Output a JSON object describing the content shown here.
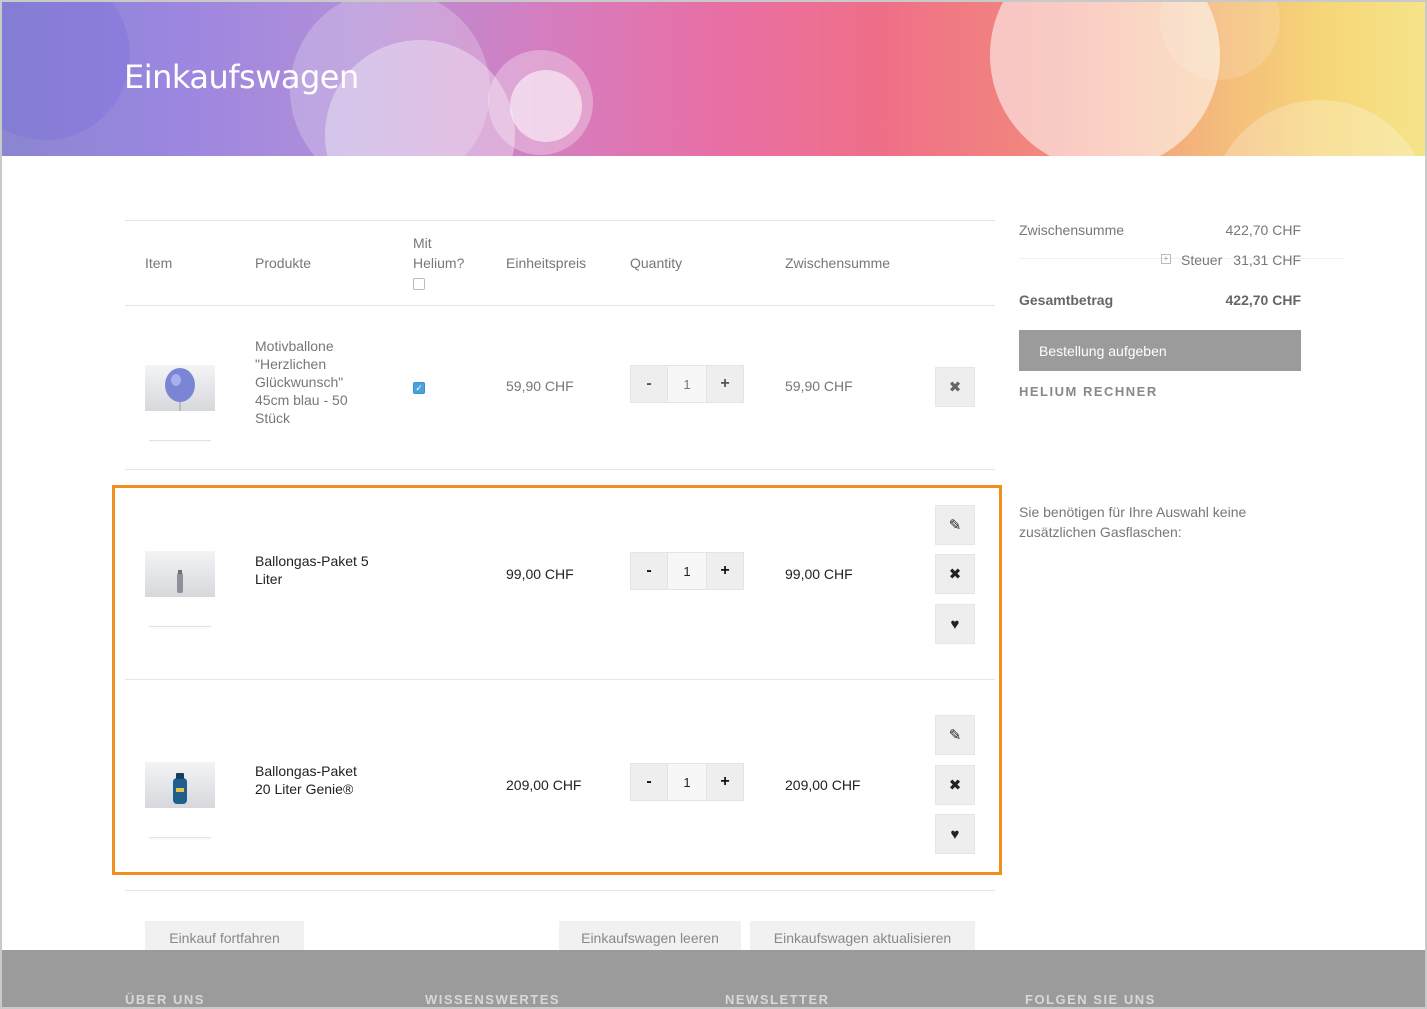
{
  "page": {
    "title": "Einkaufswagen"
  },
  "table": {
    "headers": {
      "item": "Item",
      "products": "Produkte",
      "helium_line1": "Mit",
      "helium_line2": "Helium?",
      "unit_price": "Einheitspreis",
      "quantity": "Quantity",
      "subtotal": "Zwischensumme"
    },
    "rows": [
      {
        "name_lines": [
          "Motivballone",
          "\"Herzlichen",
          "Glückwunsch\"",
          "45cm blau - 50",
          "Stück"
        ],
        "helium_checked": true,
        "unit_price": "59,90 CHF",
        "qty": "1",
        "subtotal": "59,90 CHF"
      },
      {
        "name_lines": [
          "Ballongas-Paket 5",
          "Liter"
        ],
        "unit_price": "99,00 CHF",
        "qty": "1",
        "subtotal": "99,00 CHF"
      },
      {
        "name_lines": [
          "Ballongas-Paket",
          "20 Liter Genie®"
        ],
        "unit_price": "209,00 CHF",
        "qty": "1",
        "subtotal": "209,00 CHF"
      }
    ],
    "qty_minus": "-",
    "qty_plus": "+"
  },
  "summary": {
    "subtotal_label": "Zwischensumme",
    "subtotal_value": "422,70 CHF",
    "tax_label": "Steuer",
    "tax_value": "31,31 CHF",
    "total_label": "Gesamtbetrag",
    "total_value": "422,70 CHF",
    "order_button": "Bestellung aufgeben",
    "helium_calc": "HELIUM RECHNER",
    "note": "Sie benötigen für Ihre Auswahl keine zusätzlichen Gasflaschen:"
  },
  "actions": {
    "continue": "Einkauf fortfahren",
    "clear": "Einkaufswagen leeren",
    "update": "Einkaufswagen aktualisieren"
  },
  "footer": {
    "about": "ÜBER UNS",
    "knowledge": "WISSENSWERTES",
    "newsletter": "NEWSLETTER",
    "follow": "FOLGEN SIE UNS"
  },
  "colors": {
    "highlight": "#f0901f",
    "order_button": "#9b9b9b",
    "footer": "#9b9b9b"
  }
}
